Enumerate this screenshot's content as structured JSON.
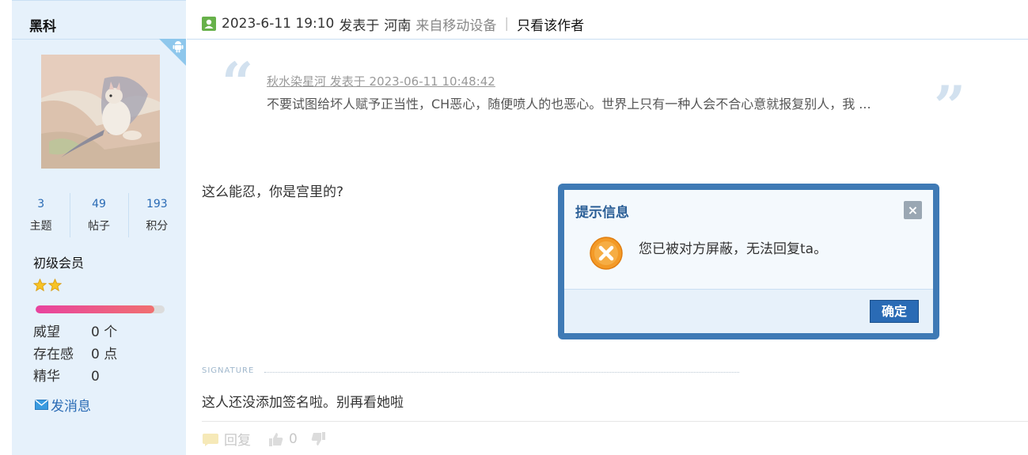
{
  "sidebar": {
    "username": "黑科",
    "stats": [
      {
        "value": "3",
        "label": "主题"
      },
      {
        "value": "49",
        "label": "帖子"
      },
      {
        "value": "193",
        "label": "积分"
      }
    ],
    "level": "初级会员",
    "star_count": 2,
    "level_progress": 0.92,
    "attributes": [
      {
        "label": "威望",
        "value": "0 个"
      },
      {
        "label": "存在感",
        "value": "0 点"
      },
      {
        "label": "精华",
        "value": "0"
      }
    ],
    "message_link": "发消息"
  },
  "post": {
    "datetime": "2023-6-11 19:10",
    "posted_at": "发表于",
    "location": "河南",
    "device": "来自移动设备",
    "separator": "|",
    "author_only": "只看该作者",
    "quote": {
      "source": "秋水染星河 发表于 2023-06-11 10:48:42",
      "text": "不要试图给坏人赋予正当性，CH恶心，随便喷人的也恶心。世界上只有一种人会不合心意就报复别人，我 ..."
    },
    "body": "这么能忍，你是宫里的?",
    "signature_label": "SIGNATURE",
    "signature": "这人还没添加签名啦。别再看她啦",
    "actions": {
      "reply": "回复",
      "like_count": "0"
    }
  },
  "dialog": {
    "title": "提示信息",
    "close": "×",
    "message": "您已被对方屏蔽，无法回复ta。",
    "ok": "确定"
  },
  "colors": {
    "sidebar_bg": "#e6f1fb",
    "link": "#2a6bb5",
    "dialog_frame": "#3f7ab5",
    "error_icon": "#f39a27"
  }
}
